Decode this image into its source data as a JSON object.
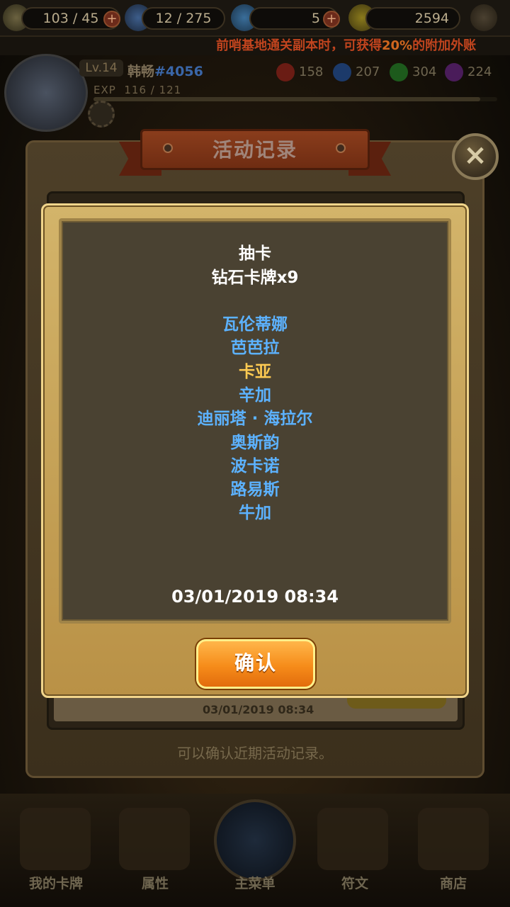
{
  "topbar": {
    "stamina": "103 / 45",
    "potion": "12 / 275",
    "diamonds": "5",
    "gold": "2594"
  },
  "ticker": {
    "text_a": "前哨基地通关副本时，可获得",
    "text_b": "20%",
    "text_c": "的附加外账"
  },
  "profile": {
    "level": "Lv.14",
    "name": "韩畅",
    "tag": "#4056",
    "exp_label": "EXP",
    "exp_value": "116 / 121",
    "exp_ratio": 0.958,
    "gems": [
      "158",
      "207",
      "304",
      "224"
    ]
  },
  "nav": {
    "items": [
      "我的卡牌",
      "属性",
      "主菜单",
      "符文",
      "商店"
    ]
  },
  "panel": {
    "title": "活动记录",
    "hint": "可以确认近期活动记录。",
    "behind_time": "03/01/2019 08:34"
  },
  "record": {
    "type": "抽卡",
    "summary": "钻石卡牌x9",
    "cards": [
      {
        "name": "瓦伦蒂娜",
        "rarity": "blue"
      },
      {
        "name": "芭芭拉",
        "rarity": "blue"
      },
      {
        "name": "卡亚",
        "rarity": "gold"
      },
      {
        "name": "辛加",
        "rarity": "blue"
      },
      {
        "name": "迪丽塔 · 海拉尔",
        "rarity": "blue"
      },
      {
        "name": "奥斯韵",
        "rarity": "blue"
      },
      {
        "name": "波卡诺",
        "rarity": "blue"
      },
      {
        "name": "路易斯",
        "rarity": "blue"
      },
      {
        "name": "牛加",
        "rarity": "blue"
      }
    ],
    "datetime": "03/01/2019 08:34"
  },
  "buttons": {
    "confirm": "确认",
    "close": "×"
  },
  "colors": {
    "blue_name": "#5cb2ff",
    "gold_name": "#ffcb52",
    "confirm_orange": "#f68c1a"
  }
}
